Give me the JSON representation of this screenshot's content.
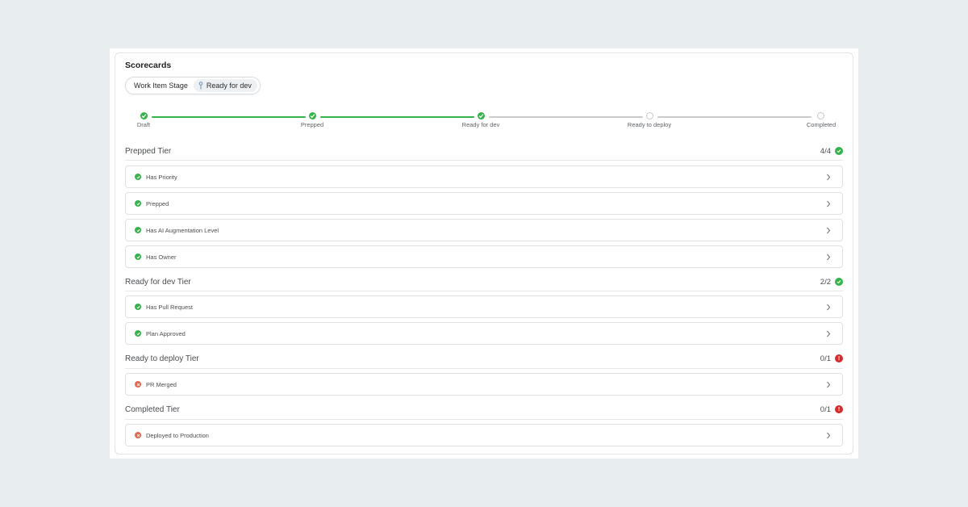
{
  "title": "Scorecards",
  "stage": {
    "label": "Work Item Stage",
    "value": "Ready for dev",
    "icon": "pin-icon"
  },
  "progress": {
    "steps": [
      {
        "label": "Draft",
        "status": "done"
      },
      {
        "label": "Prepped",
        "status": "done"
      },
      {
        "label": "Ready for dev",
        "status": "done"
      },
      {
        "label": "Ready to deploy",
        "status": "todo"
      },
      {
        "label": "Completed",
        "status": "todo"
      }
    ]
  },
  "colors": {
    "success": "#34b34a",
    "error": "#d62b2b",
    "error_soft": "#e8674f",
    "pending": "#c6c9cc"
  },
  "tiers": [
    {
      "title": "Prepped Tier",
      "count": "4/4",
      "status": "ok",
      "rules": [
        {
          "label": "Has Priority",
          "status": "ok"
        },
        {
          "label": "Prepped",
          "status": "ok"
        },
        {
          "label": "Has AI Augmentation Level",
          "status": "ok"
        },
        {
          "label": "Has Owner",
          "status": "ok"
        }
      ]
    },
    {
      "title": "Ready for dev Tier",
      "count": "2/2",
      "status": "ok",
      "rules": [
        {
          "label": "Has Pull Request",
          "status": "ok"
        },
        {
          "label": "Plan Approved",
          "status": "ok"
        }
      ]
    },
    {
      "title": "Ready to deploy Tier",
      "count": "0/1",
      "status": "err",
      "rules": [
        {
          "label": "PR Merged",
          "status": "err"
        }
      ]
    },
    {
      "title": "Completed Tier",
      "count": "0/1",
      "status": "err",
      "rules": [
        {
          "label": "Deployed to Production",
          "status": "err"
        }
      ]
    }
  ]
}
